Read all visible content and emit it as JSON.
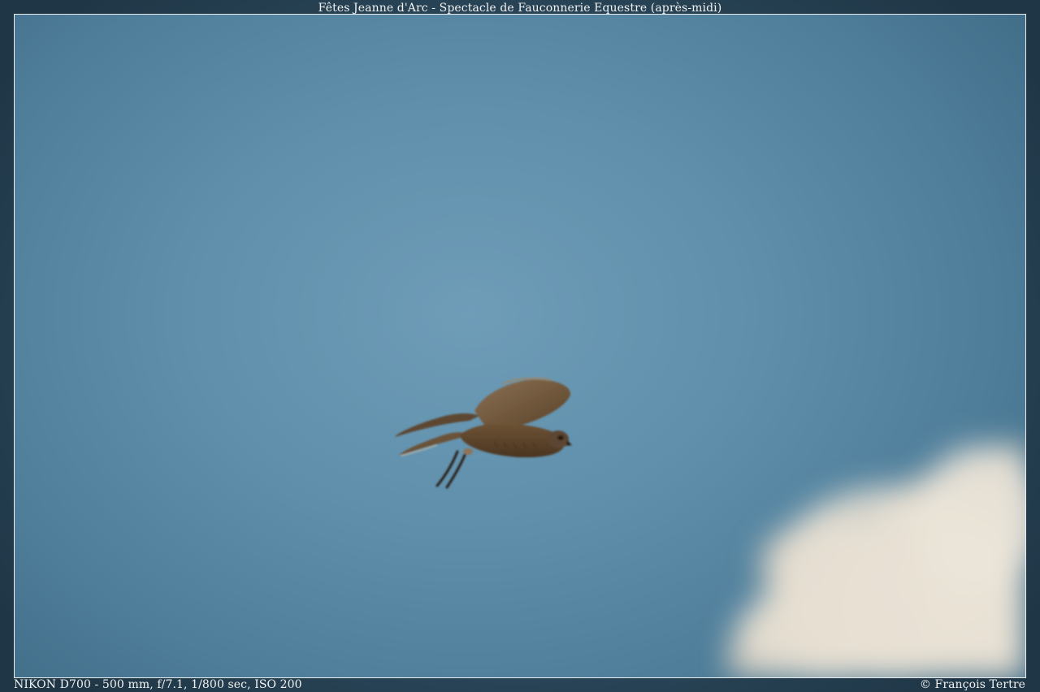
{
  "title": "Fêtes Jeanne d'Arc - Spectacle de Fauconnerie Equestre (après-midi)",
  "exif": "NIKON D700 - 500 mm, f/7.1, 1/800 sec, ISO 200",
  "copyright": "© François Tertre",
  "photo": {
    "subject": "falcon-in-flight",
    "sky_color": "#6a98b4",
    "cloud_color": "#e4ddd0",
    "bird_color": "#6b5236"
  }
}
